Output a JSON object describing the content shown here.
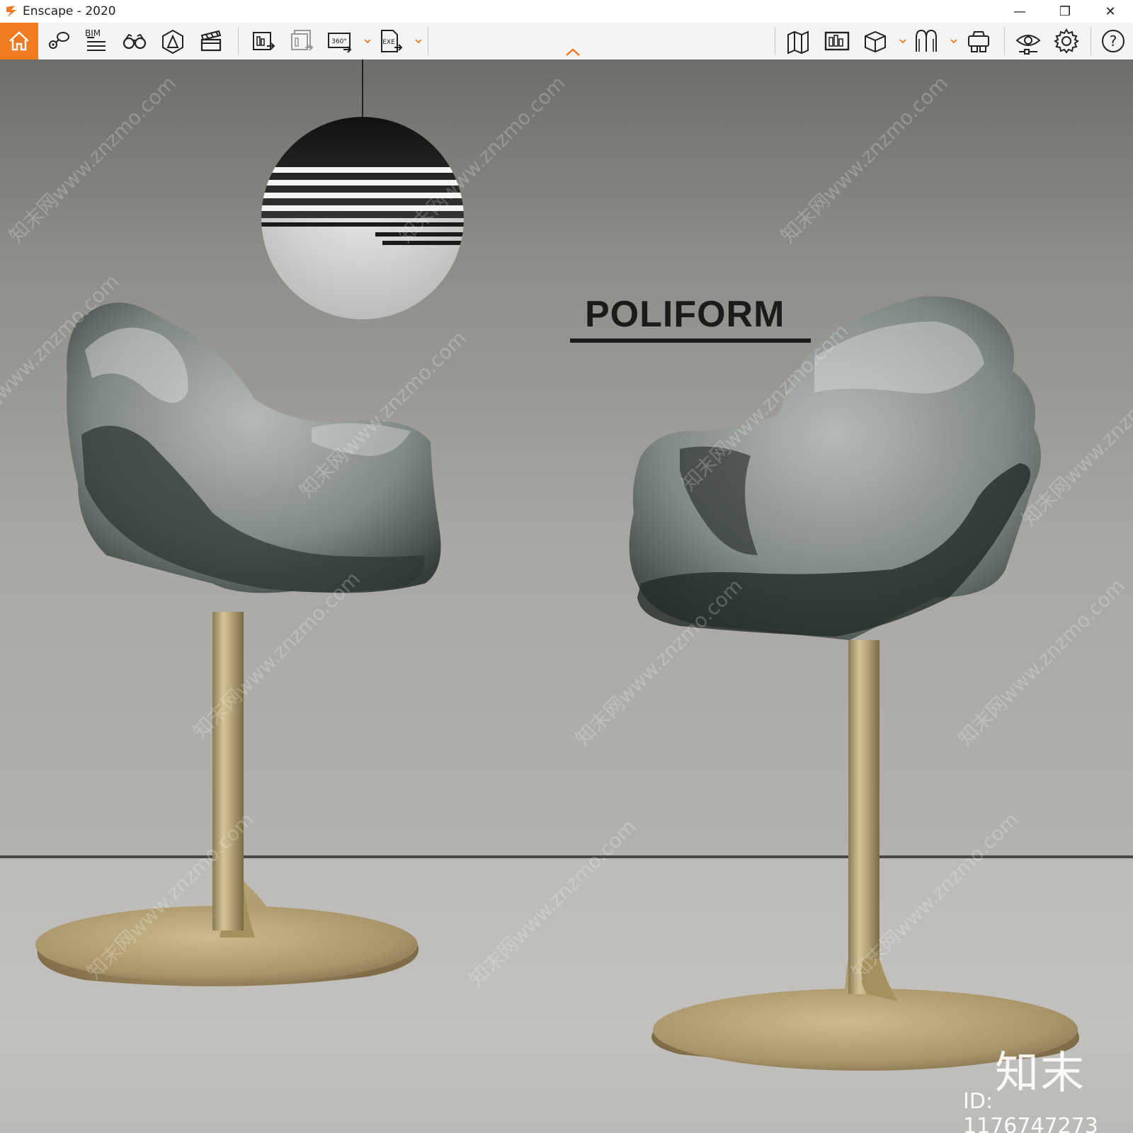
{
  "window": {
    "title": "Enscape - 2020",
    "minimize_glyph": "—",
    "restore_glyph": "❐",
    "close_glyph": "✕"
  },
  "toolbar": {
    "bim_label": "BIM",
    "accent_color": "#f07a22",
    "left_icons": [
      "home-icon",
      "views-icon",
      "bim-icon",
      "binoculars-icon",
      "atmosphere-icon",
      "video-editor-icon",
      "render-image-icon",
      "batch-render-icon",
      "render-360-icon",
      "export-exe-icon"
    ],
    "right_icons": [
      "map-icon",
      "screenshot-gallery-icon",
      "asset-library-icon",
      "material-icon",
      "vr-headset-icon",
      "visual-settings-icon",
      "settings-icon",
      "help-icon"
    ]
  },
  "scene": {
    "brand_text": "POLIFORM",
    "watermark_text": "知末网www.znzmo.com",
    "watermark_logo": "知末",
    "watermark_id": "ID: 1176747273"
  }
}
